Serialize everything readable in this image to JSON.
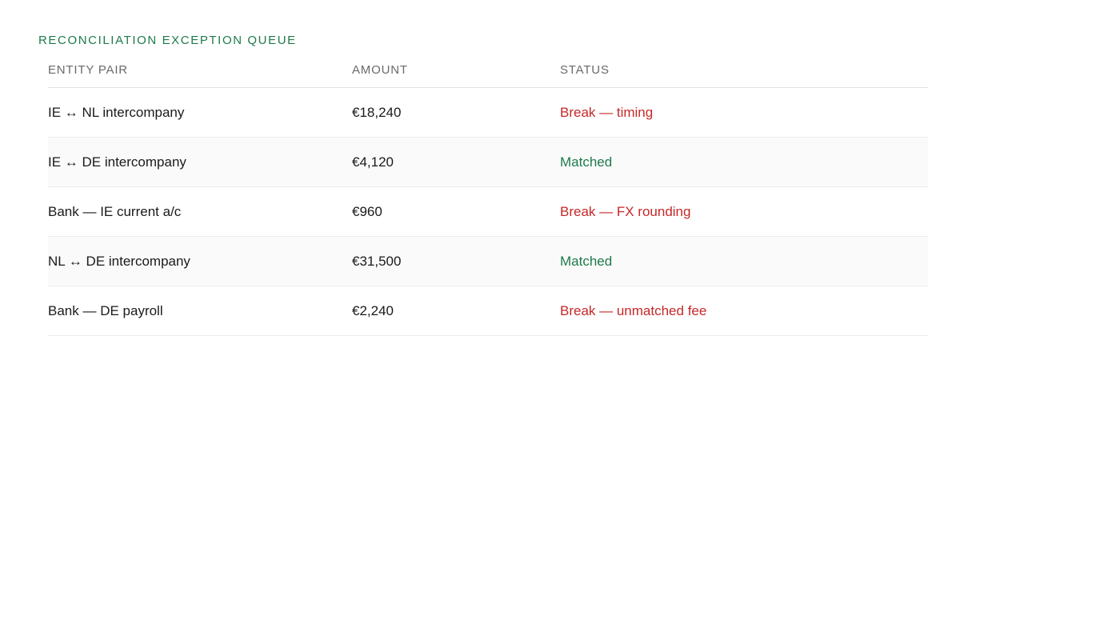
{
  "title": "RECONCILIATION EXCEPTION QUEUE",
  "columns": {
    "entity": "ENTITY PAIR",
    "amount": "AMOUNT",
    "status": "STATUS"
  },
  "rows": [
    {
      "entity": "IE ↔ NL intercompany",
      "amount": "€18,240",
      "status": "Break — timing",
      "status_type": "break"
    },
    {
      "entity": "IE ↔ DE intercompany",
      "amount": "€4,120",
      "status": "Matched",
      "status_type": "matched"
    },
    {
      "entity": "Bank — IE current a/c",
      "amount": "€960",
      "status": "Break — FX rounding",
      "status_type": "break"
    },
    {
      "entity": "NL ↔ DE intercompany",
      "amount": "€31,500",
      "status": "Matched",
      "status_type": "matched"
    },
    {
      "entity": "Bank — DE payroll",
      "amount": "€2,240",
      "status": "Break — unmatched fee",
      "status_type": "break"
    }
  ],
  "colors": {
    "accent": "#1e7a4c",
    "break": "#c62828",
    "matched": "#1e7a4c"
  }
}
